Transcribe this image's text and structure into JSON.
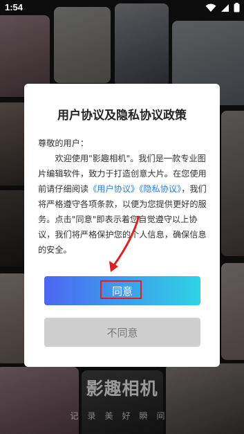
{
  "status_bar": {
    "time": "1:54"
  },
  "dialog": {
    "title": "用户协议及隐私协议政策",
    "greeting": "尊敬的用户：",
    "body": {
      "part1": "欢迎使用\"影趣相机\"。我们是一款专业图片编辑软件，致力于打造创意大片。在您使用前请仔细阅读",
      "link_user_agreement": "《用户协议》",
      "link_privacy": "《隐私协议》",
      "part2": "，我们将严格遵守各项条款，以便为您提供更好的服务。点击\"同意\"即表示着您自觉遵守以上协议，我们将严格保护您的个人信息，确保信息的安全。"
    },
    "agree_button": "同意",
    "disagree_button": "不同意"
  },
  "brand": {
    "name": "影趣相机",
    "slogan": "记录美好瞬间"
  },
  "colors": {
    "link": "#2b7de9",
    "button_gradient_start": "#4c66f2",
    "button_gradient_end": "#2fd3e6",
    "highlight_box": "#e31c1c",
    "disabled_button": "#cfcfcf"
  },
  "icons": [
    "wifi-icon",
    "signal-icon",
    "battery-icon",
    "annotation-arrow-icon"
  ]
}
